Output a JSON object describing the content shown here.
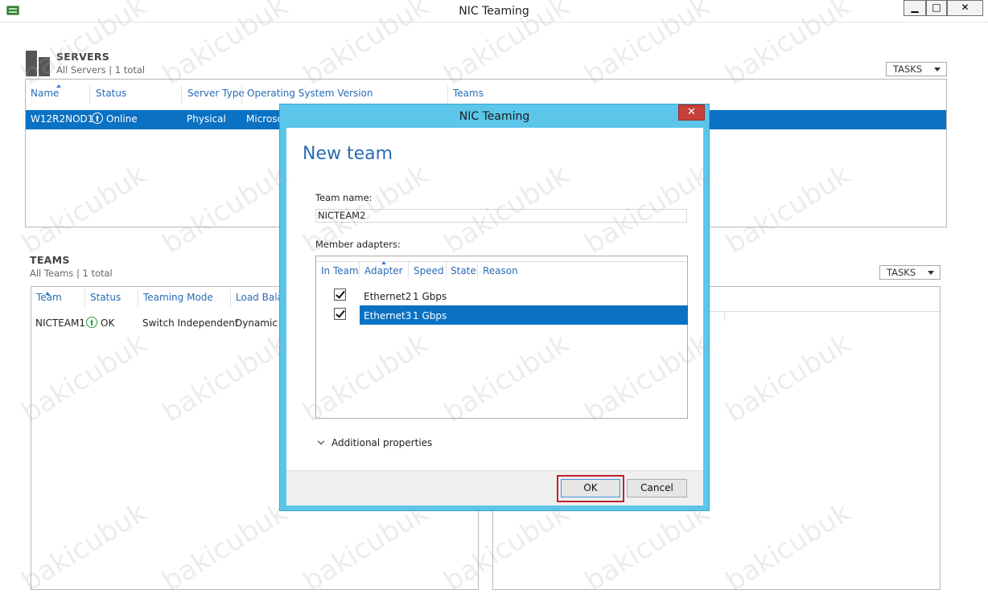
{
  "window": {
    "title": "NIC Teaming",
    "min_glyph": "▁",
    "max_glyph": "□",
    "close_glyph": "✕"
  },
  "servers": {
    "title": "SERVERS",
    "subtitle": "All Servers | 1 total",
    "tasks_label": "TASKS",
    "columns": [
      "Name",
      "Status",
      "Server Type",
      "Operating System Version",
      "Teams"
    ],
    "rows": [
      {
        "name": "W12R2NOD1",
        "status": "Online",
        "server_type": "Physical",
        "os_version": "Microso"
      }
    ]
  },
  "teams": {
    "title": "TEAMS",
    "subtitle": "All Teams | 1 total",
    "tasks_label": "TASKS",
    "columns": [
      "Team",
      "Status",
      "Teaming Mode",
      "Load Balar"
    ],
    "rows": [
      {
        "team": "NICTEAM1",
        "status": "OK",
        "mode": "Switch Independent",
        "load_balancing": "Dynamic"
      }
    ]
  },
  "dialog": {
    "title": "NIC Teaming",
    "close_glyph": "✕",
    "heading": "New team",
    "team_name_label": "Team name:",
    "team_name_value": "NICTEAM2",
    "member_adapters_label": "Member adapters:",
    "adapter_columns": [
      "In Team",
      "Adapter",
      "Speed",
      "State",
      "Reason"
    ],
    "adapters": [
      {
        "in_team": true,
        "adapter": "Ethernet2",
        "speed": "1 Gbps",
        "selected": false
      },
      {
        "in_team": true,
        "adapter": "Ethernet3",
        "speed": "1 Gbps",
        "selected": true
      }
    ],
    "additional_properties_label": "Additional properties",
    "ok_label": "OK",
    "cancel_label": "Cancel"
  },
  "watermark": "bakicubuk",
  "colors": {
    "selection": "#0b71c2",
    "header_link": "#2a6bb5",
    "dialog_frame": "#5bc6ea",
    "status_ok": "#2f9e44",
    "highlight_outline": "#c0232b"
  }
}
